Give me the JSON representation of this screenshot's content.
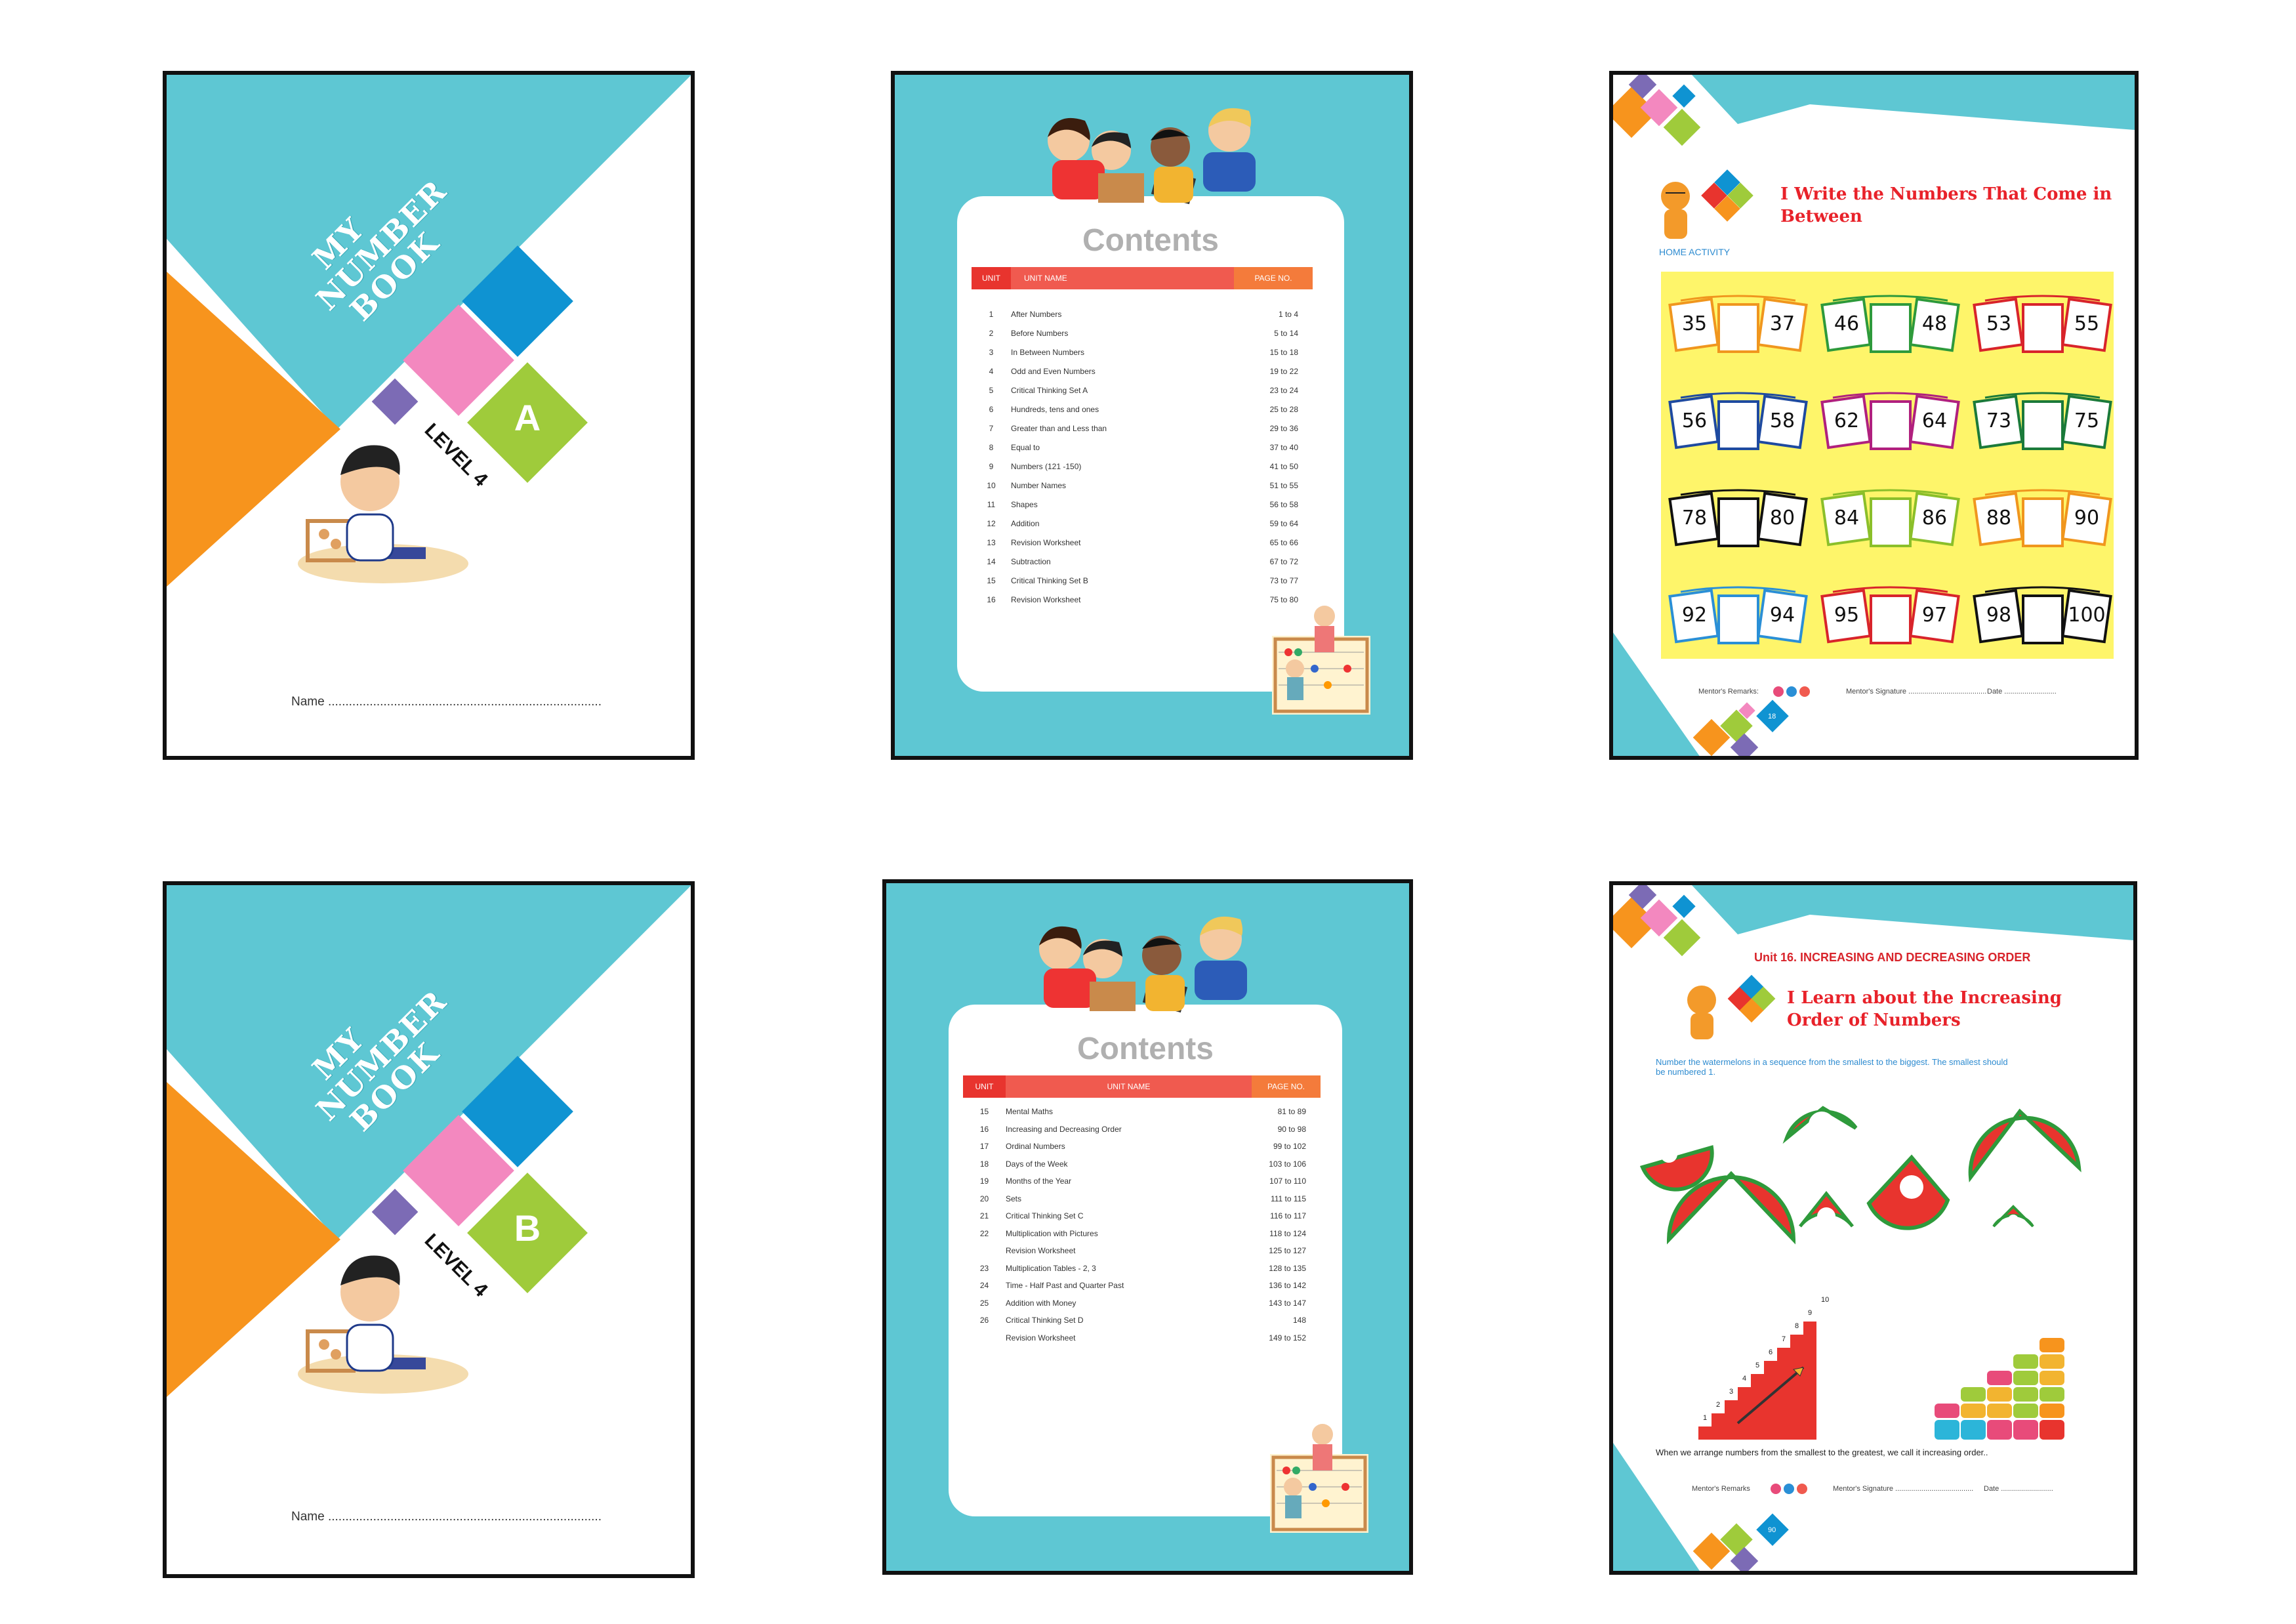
{
  "covers": [
    {
      "title_lines": [
        "MY",
        "NUMBER",
        "BOOK"
      ],
      "level": "LEVEL 4",
      "letter": "A",
      "name_label": "Name ..............................................................................."
    },
    {
      "title_lines": [
        "MY",
        "NUMBER",
        "BOOK"
      ],
      "level": "LEVEL 4",
      "letter": "B",
      "name_label": "Name ..............................................................................."
    }
  ],
  "contents_a": {
    "title": "Contents",
    "headers": [
      "UNIT",
      "UNIT NAME",
      "PAGE NO."
    ],
    "rows": [
      [
        "1",
        "After Numbers",
        "1 to 4"
      ],
      [
        "2",
        "Before Numbers",
        "5 to 14"
      ],
      [
        "3",
        "In Between Numbers",
        "15 to 18"
      ],
      [
        "4",
        "Odd and Even Numbers",
        "19 to 22"
      ],
      [
        "5",
        "Critical Thinking Set A",
        "23 to 24"
      ],
      [
        "6",
        "Hundreds, tens and ones",
        "25 to 28"
      ],
      [
        "7",
        "Greater than and Less than",
        "29 to 36"
      ],
      [
        "8",
        "Equal to",
        "37 to 40"
      ],
      [
        "9",
        "Numbers (121 -150)",
        "41 to 50"
      ],
      [
        "10",
        "Number Names",
        "51 to 55"
      ],
      [
        "11",
        "Shapes",
        "56 to 58"
      ],
      [
        "12",
        "Addition",
        "59 to 64"
      ],
      [
        "13",
        "Revision Worksheet",
        "65 to 66"
      ],
      [
        "14",
        "Subtraction",
        "67 to 72"
      ],
      [
        "15",
        "Critical Thinking Set B",
        "73 to 77"
      ],
      [
        "16",
        "Revision Worksheet",
        "75 to 80"
      ]
    ]
  },
  "contents_b": {
    "title": "Contents",
    "headers": [
      "UNIT",
      "UNIT NAME",
      "PAGE NO."
    ],
    "rows": [
      [
        "15",
        "Mental Maths",
        "81 to 89"
      ],
      [
        "16",
        "Increasing and Decreasing Order",
        "90 to 98"
      ],
      [
        "17",
        "Ordinal Numbers",
        "99 to 102"
      ],
      [
        "18",
        "Days of the Week",
        "103 to 106"
      ],
      [
        "19",
        "Months of the Year",
        "107 to 110"
      ],
      [
        "20",
        "Sets",
        "111 to 115"
      ],
      [
        "21",
        "Critical Thinking Set C",
        "116 to 117"
      ],
      [
        "22",
        "Multiplication with Pictures",
        "118 to 124"
      ],
      [
        "",
        "Revision Worksheet",
        "125 to 127"
      ],
      [
        "23",
        "Multiplication Tables - 2, 3",
        "128 to 135"
      ],
      [
        "24",
        "Time - Half Past and Quarter Past",
        "136 to 142"
      ],
      [
        "25",
        "Addition with Money",
        "143 to 147"
      ],
      [
        "26",
        "Critical Thinking Set D",
        "148"
      ],
      [
        "",
        "Revision Worksheet",
        "149 to 152"
      ]
    ]
  },
  "worksheet_1": {
    "title_line1": "I Write the Numbers That Come in",
    "title_line2": "Between",
    "subtitle": "HOME ACTIVITY",
    "pairs": [
      {
        "a": "35",
        "b": "37",
        "color": "#f0961e"
      },
      {
        "a": "46",
        "b": "48",
        "color": "#2e9a3b"
      },
      {
        "a": "53",
        "b": "55",
        "color": "#d8242b"
      },
      {
        "a": "56",
        "b": "58",
        "color": "#1e4aa0"
      },
      {
        "a": "62",
        "b": "64",
        "color": "#b0207e"
      },
      {
        "a": "73",
        "b": "75",
        "color": "#1b7a3a"
      },
      {
        "a": "78",
        "b": "80",
        "color": "#111111"
      },
      {
        "a": "84",
        "b": "86",
        "color": "#8bbf2a"
      },
      {
        "a": "88",
        "b": "90",
        "color": "#f0961e"
      },
      {
        "a": "92",
        "b": "94",
        "color": "#2a8fd6"
      },
      {
        "a": "95",
        "b": "97",
        "color": "#d8242b"
      },
      {
        "a": "98",
        "b": "100",
        "color": "#111111"
      }
    ],
    "mentor_remarks": "Mentor's Remarks:",
    "mentor_signature": "Mentor's Signature .......................................",
    "date": "Date ..........................",
    "page_number": "18"
  },
  "worksheet_2": {
    "unit_banner": "Unit 16. INCREASING AND DECREASING ORDER",
    "title_line1": "I Learn about the Increasing",
    "title_line2": "Order of Numbers",
    "instruction_line1": "Number the watermelons in a sequence from the smallest to the biggest. The smallest should",
    "instruction_line2": "be numbered 1.",
    "steps": [
      "1",
      "2",
      "3",
      "4",
      "5",
      "6",
      "7",
      "8",
      "9",
      "10"
    ],
    "summary": "When we arrange numbers from the smallest to the greatest, we call it increasing order..",
    "mentor_remarks": "Mentor's Remarks",
    "mentor_signature": "Mentor's Signature .......................................",
    "date": "Date ..........................",
    "page_number": "90"
  }
}
